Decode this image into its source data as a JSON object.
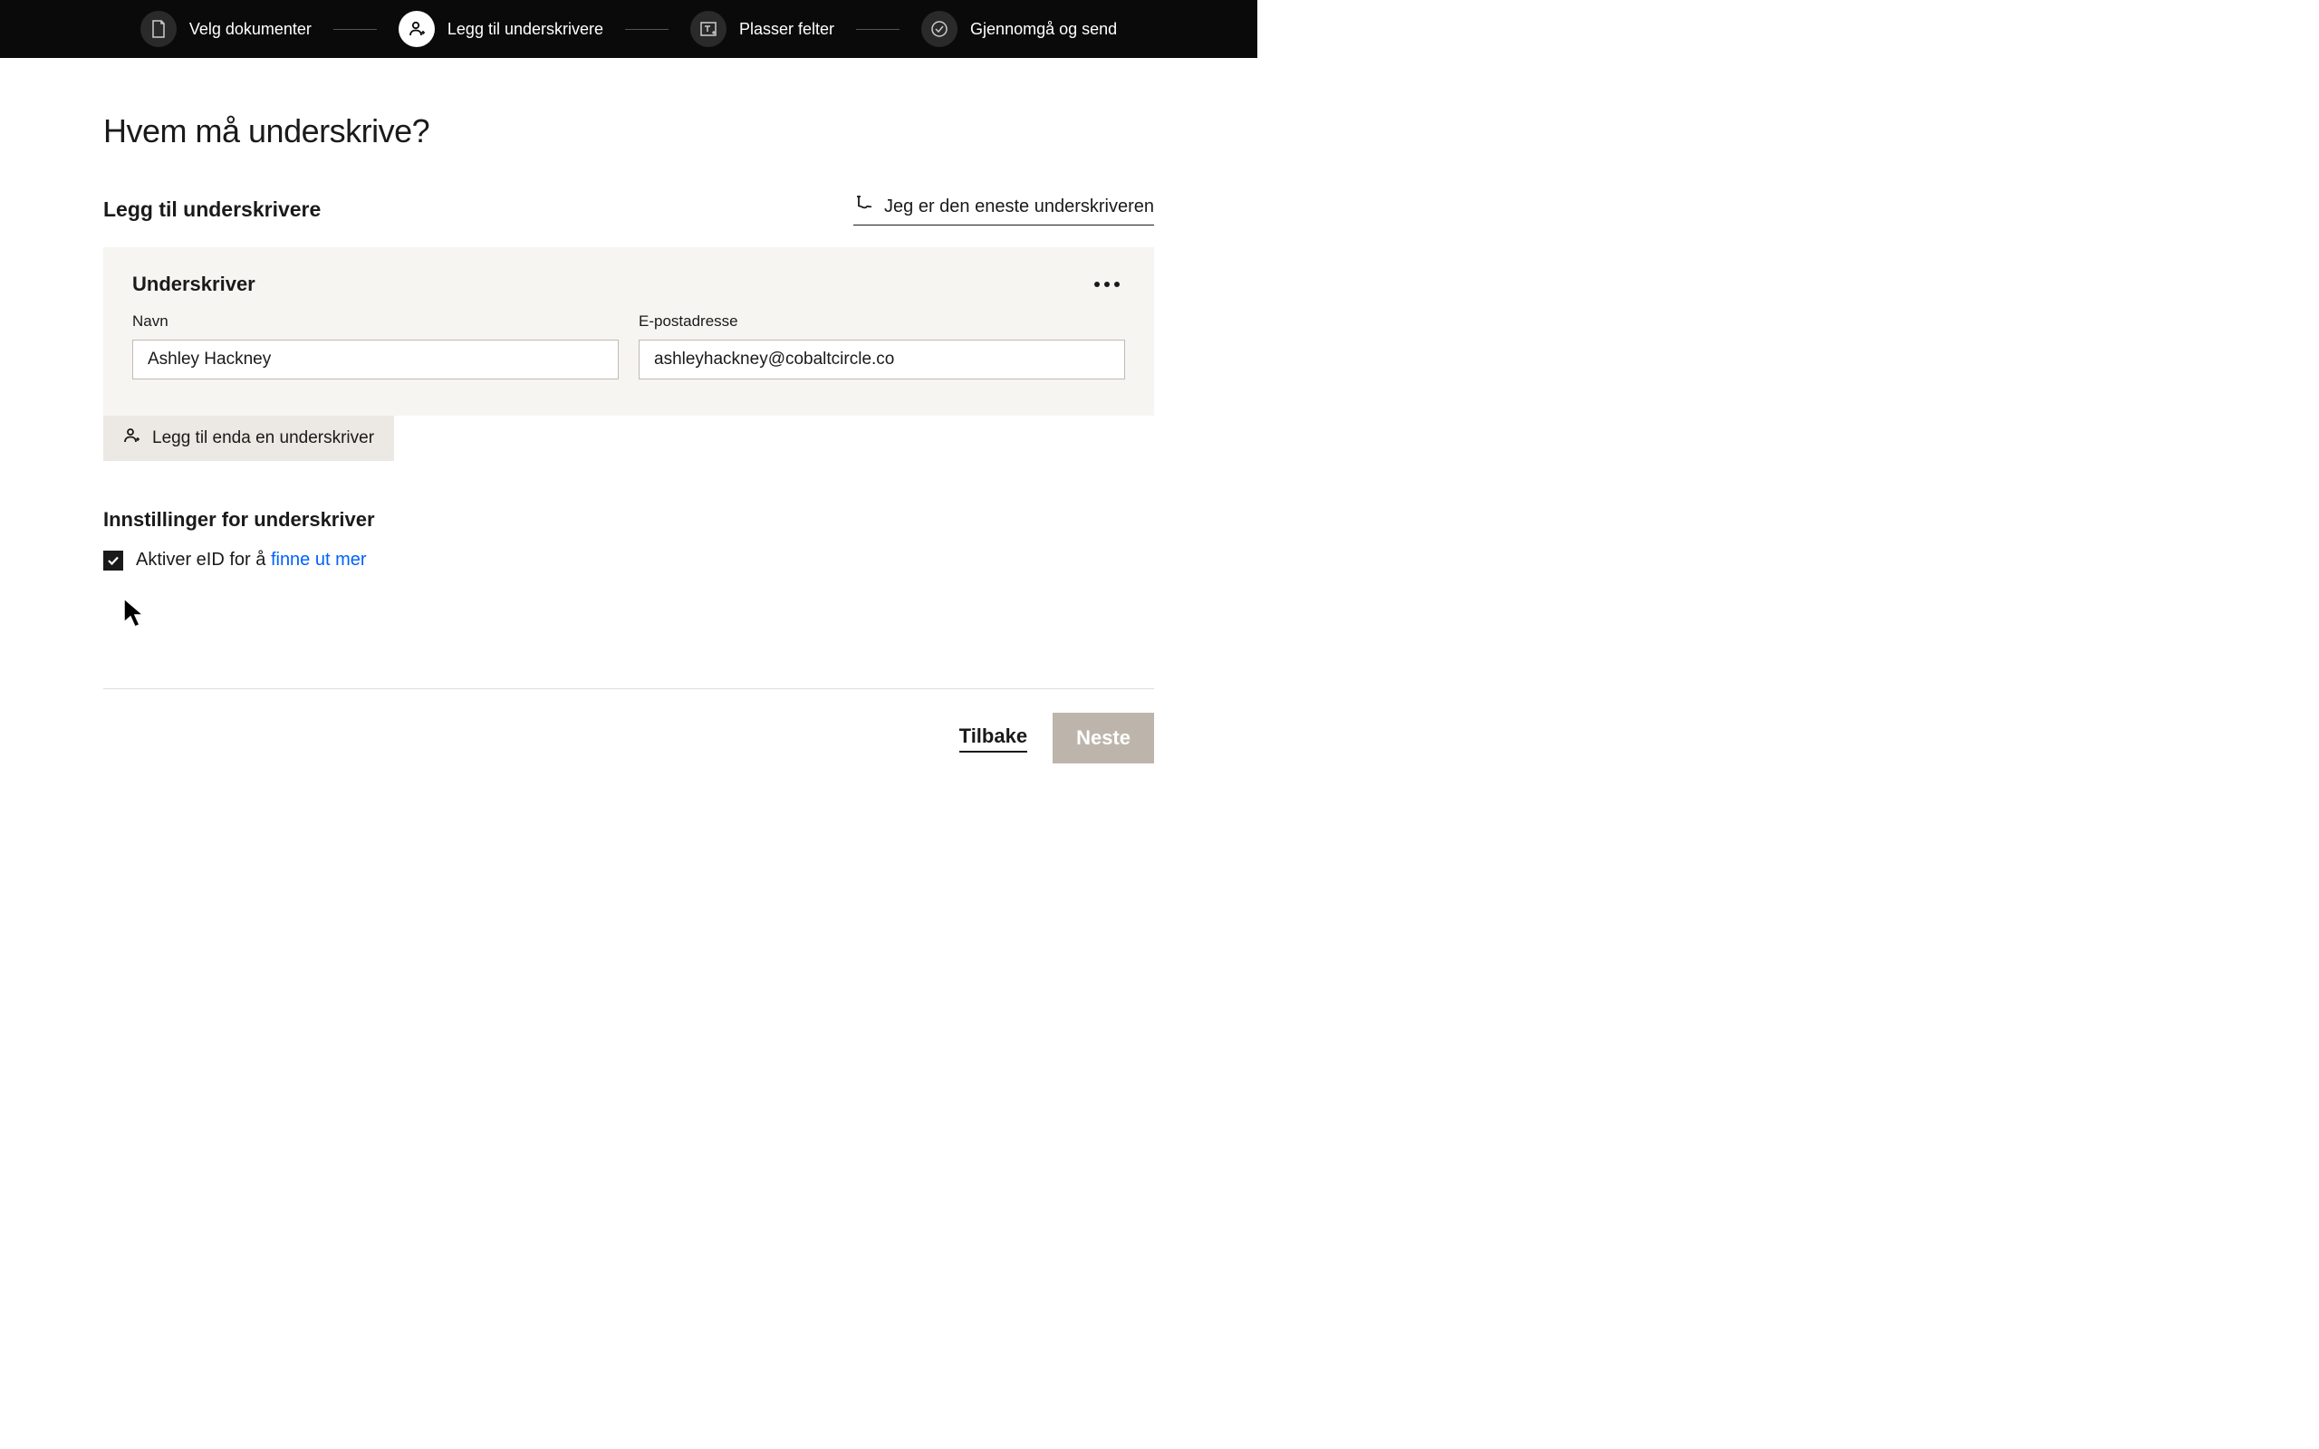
{
  "stepper": {
    "steps": [
      {
        "label": "Velg dokumenter",
        "icon": "document-icon",
        "active": false
      },
      {
        "label": "Legg til underskrivere",
        "icon": "person-plus-icon",
        "active": true
      },
      {
        "label": "Plasser felter",
        "icon": "text-field-icon",
        "active": false
      },
      {
        "label": "Gjennomgå og send",
        "icon": "check-circle-icon",
        "active": false
      }
    ]
  },
  "page_title": "Hvem må underskrive?",
  "section_heading": "Legg til underskrivere",
  "only_signer_label": "Jeg er den eneste underskriveren",
  "signer": {
    "title": "Underskriver",
    "name_label": "Navn",
    "name_value": "Ashley Hackney",
    "email_label": "E-postadresse",
    "email_value": "ashleyhackney@cobaltcircle.co"
  },
  "add_signer_label": "Legg til enda en underskriver",
  "settings": {
    "heading": "Innstillinger for underskriver",
    "checkbox_checked": true,
    "checkbox_text": "Aktiver eID for å ",
    "checkbox_link": "finne ut mer"
  },
  "footer": {
    "back_label": "Tilbake",
    "next_label": "Neste"
  }
}
